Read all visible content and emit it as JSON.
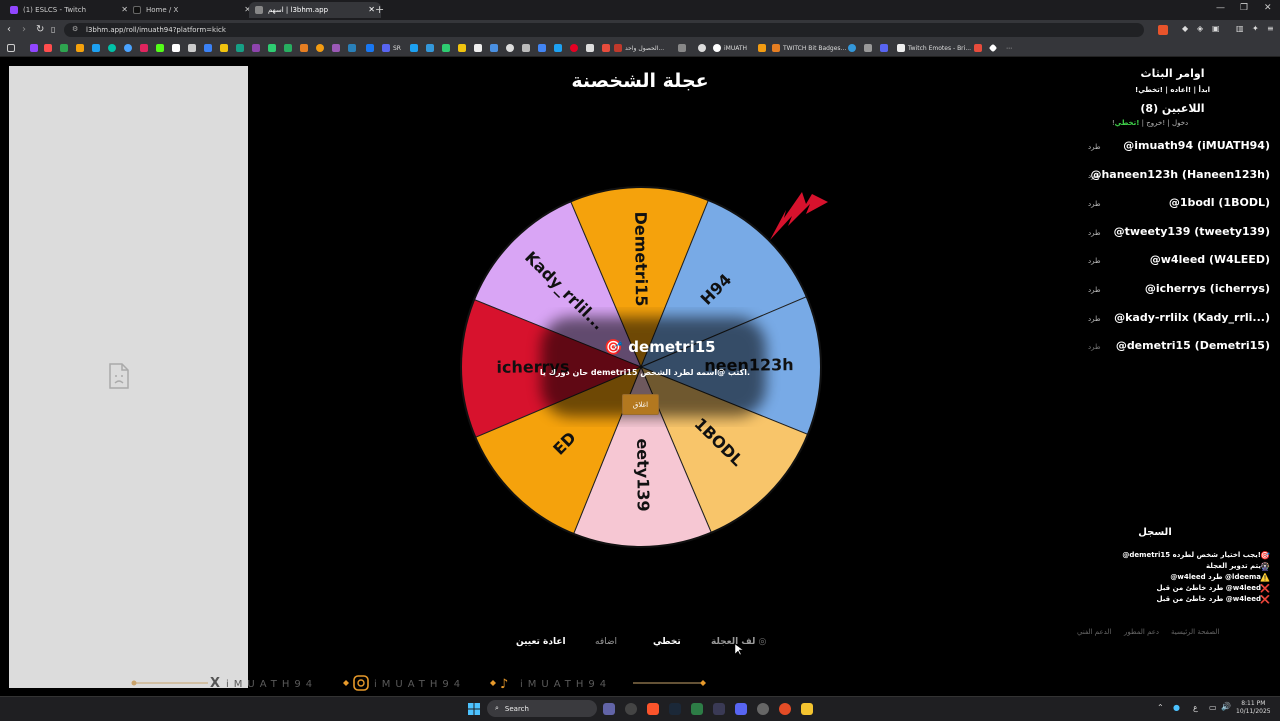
{
  "browser": {
    "tabs": [
      {
        "title": "(1) ESLCS - Twitch",
        "color": "#9146ff"
      },
      {
        "title": "Home / X",
        "color": "#ffffff"
      },
      {
        "title": "اسهم | l3bhm.app",
        "color": "#aaaaaa"
      }
    ],
    "new_tab": "+",
    "url": "l3bhm.app/roll/imuath94?platform=kick",
    "bookmarks": [
      {
        "label": "SR"
      },
      {
        "label": "الحصول واحد..."
      },
      {
        "label": "iMUATH"
      },
      {
        "label": "TWITCH Bit Badges..."
      },
      {
        "label": "Twitch Emotes - Bri..."
      }
    ]
  },
  "page": {
    "title": "عجلة الشخصنة",
    "colors": {
      "orange": "#f5a20c",
      "blue": "#78aae6",
      "green": "#3fd14a",
      "accent_red": "#d7122d"
    }
  },
  "wheel": {
    "segments": [
      {
        "label": "Kady_rrlil...",
        "color": "#d9a5f5"
      },
      {
        "label": "Demetri15",
        "color": "#f5a20c"
      },
      {
        "label": "imuath94",
        "visible_text": "H94",
        "color": "#78aae6"
      },
      {
        "label": "haneen123h",
        "visible_text": "neen123h",
        "color": "#78aae6"
      },
      {
        "label": "1BODL",
        "color": "#f8c56a"
      },
      {
        "label": "tweety139",
        "visible_text": "eety139",
        "color": "#f6c7d3"
      },
      {
        "label": "W4LEED",
        "visible_text": "ED",
        "color": "#f5a20c"
      },
      {
        "label": "icherrys",
        "color": "#d7122d"
      }
    ],
    "result": {
      "icon": "🎯",
      "name": "demetri15",
      "message": "حان دورك يا demetri15 اكتب @اسمه لطرد الشخص.",
      "close_label": "اغلاق"
    }
  },
  "sidebar": {
    "commands_title": "اوامر البثاث",
    "commands": "!ابدأ | !اعاده | !تخطي",
    "players_title": "اللاعبين (8)",
    "player_cmds": {
      "join": "!دخول",
      "leave": "!خروج",
      "skip": "!تخطي"
    },
    "kick_label": "طرد",
    "players": [
      "@imuath94 (iMUATH94)",
      "@haneen123h (Haneen123h)",
      "@1bodl (1BODL)",
      "@tweety139 (tweety139)",
      "@w4leed (W4LEED)",
      "@icherrys (icherrys)",
      "@kady-rrlilx (Kady_rrli...)",
      "@demetri15 (Demetri15)"
    ],
    "log_title": "السجل",
    "log": [
      {
        "icon": "🎯",
        "text": "@demetri15 يجب اختيار شخص لطرده!"
      },
      {
        "icon": "🎡",
        "text": "يتم تدوير العجلة"
      },
      {
        "icon": "⚠️",
        "text": "@w4leed طرد @ldeema"
      },
      {
        "icon": "❌",
        "text": "طرد خاطئ من قبل @w4leed"
      },
      {
        "icon": "❌",
        "text": "طرد خاطئ من قبل @w4leed"
      }
    ],
    "footer_links": [
      "الصفحة الرئيسية",
      "دعم المطور",
      "الدعم الفني"
    ]
  },
  "controls": {
    "spin": "لف العجلة",
    "skip": "تخطي",
    "add": "اضافه",
    "reset": "اعادة تعيين"
  },
  "ticker": {
    "text": "iMUATH94"
  },
  "taskbar": {
    "search": "Search",
    "time": "8:11 PM",
    "date": "10/11/2025"
  }
}
